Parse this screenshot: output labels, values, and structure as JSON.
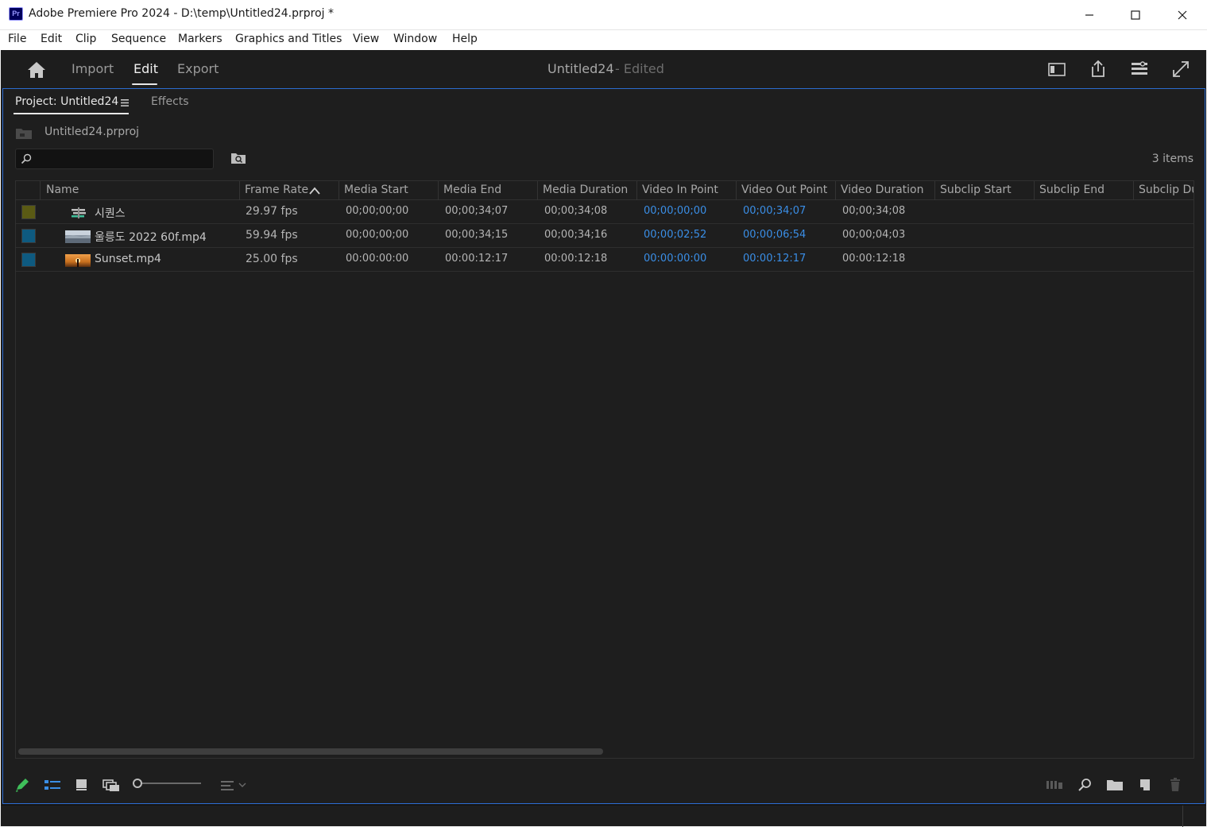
{
  "window": {
    "app_badge": "Pr",
    "title": "Adobe Premiere Pro 2024 - D:\\temp\\Untitled24.prproj *",
    "minimize_icon": "minimize-icon",
    "maximize_icon": "maximize-icon",
    "close_icon": "close-icon"
  },
  "menu": [
    "File",
    "Edit",
    "Clip",
    "Sequence",
    "Markers",
    "Graphics and Titles",
    "View",
    "Window",
    "Help"
  ],
  "header": {
    "tabs": [
      "Import",
      "Edit",
      "Export"
    ],
    "active_tab": "Edit",
    "doc_title": "Untitled24",
    "doc_status": "- Edited",
    "icons": [
      "home-icon",
      "quick-export-panel-icon",
      "share-icon",
      "workspaces-icon",
      "fullscreen-icon"
    ]
  },
  "panel": {
    "tabs": [
      "Project: Untitled24",
      "Effects"
    ],
    "active_tab": "Project: Untitled24",
    "project_file": "Untitled24.prproj",
    "search_value": "",
    "item_count": "3 items"
  },
  "list": {
    "columns": [
      "Name",
      "Frame Rate",
      "Media Start",
      "Media End",
      "Media Duration",
      "Video In Point",
      "Video Out Point",
      "Video Duration",
      "Subclip Start",
      "Subclip End",
      "Subclip Du"
    ],
    "sorted_column": "Frame Rate",
    "sort_direction": "ascending",
    "rows": [
      {
        "label_color": "#5a5a14",
        "icon": "sequence-icon",
        "name": "시퀀스",
        "frame_rate": "29.97 fps",
        "media_start": "00;00;00;00",
        "media_end": "00;00;34;07",
        "media_duration": "00;00;34;08",
        "video_in": "00;00;00;00",
        "video_out": "00;00;34;07",
        "video_duration": "00;00;34;08"
      },
      {
        "label_color": "#0e5a80",
        "icon": "video-thumbnail-icon",
        "name": "울릉도 2022 60f.mp4",
        "frame_rate": "59.94 fps",
        "media_start": "00;00;00;00",
        "media_end": "00;00;34;15",
        "media_duration": "00;00;34;16",
        "video_in": "00;00;02;52",
        "video_out": "00;00;06;54",
        "video_duration": "00;00;04;03"
      },
      {
        "label_color": "#0e5a80",
        "icon": "sunset-thumbnail-icon",
        "name": "Sunset.mp4",
        "frame_rate": "25.00 fps",
        "media_start": "00:00:00:00",
        "media_end": "00:00:12:17",
        "media_duration": "00:00:12:18",
        "video_in": "00:00:00:00",
        "video_out": "00:00:12:17",
        "video_duration": "00:00:12:18"
      }
    ]
  },
  "footer": {
    "left_icons": [
      "write-protect-pencil-icon",
      "list-view-icon",
      "icon-view-icon",
      "freeform-view-icon",
      "zoom-slider",
      "sort-icons-icon"
    ],
    "right_icons": [
      "automate-to-sequence-icon",
      "find-icon",
      "new-bin-icon",
      "new-item-icon",
      "clear-trash-icon"
    ]
  },
  "colors": {
    "accent_blue": "#2b6bcf",
    "timecode_blue": "#3a8ee6",
    "background": "#1d1d1d"
  }
}
